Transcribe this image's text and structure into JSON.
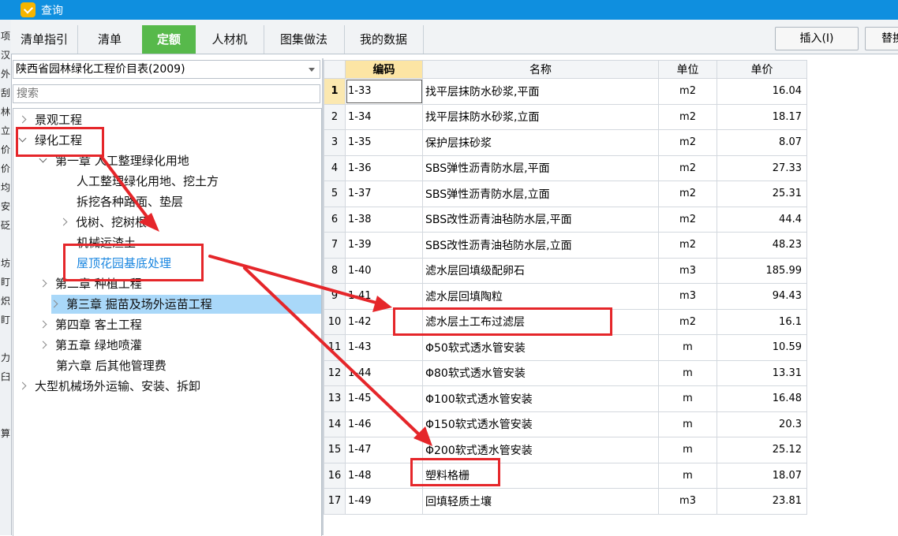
{
  "window": {
    "title": "查询"
  },
  "edge_chars": [
    "项",
    "汉",
    "外",
    "刮",
    "林",
    "立",
    "价",
    "价",
    "均",
    "安",
    "砭",
    "",
    "坊",
    "盯",
    "炽",
    "盯",
    "",
    "力",
    "臼",
    "",
    "",
    "算"
  ],
  "tabs": [
    {
      "label": "清单指引",
      "active": false
    },
    {
      "label": "清单",
      "active": false
    },
    {
      "label": "定额",
      "active": true
    },
    {
      "label": "人材机",
      "active": false
    },
    {
      "label": "图集做法",
      "active": false
    },
    {
      "label": "我的数据",
      "active": false
    }
  ],
  "toolbar": {
    "insert_label": "插入(I)",
    "replace_label": "替换"
  },
  "library": {
    "selected": "陕西省园林绿化工程价目表(2009)"
  },
  "search": {
    "placeholder": "搜索",
    "value": ""
  },
  "tree": [
    {
      "label": "景观工程",
      "level": 0,
      "toggle": "collapsed"
    },
    {
      "label": "绿化工程",
      "level": 0,
      "toggle": "expanded"
    },
    {
      "label": "第一章 人工整理绿化用地",
      "level": 1,
      "toggle": "expanded"
    },
    {
      "label": "人工整理绿化用地、挖土方",
      "level": 2,
      "toggle": "none"
    },
    {
      "label": "拆挖各种路面、垫层",
      "level": 2,
      "toggle": "none"
    },
    {
      "label": "伐树、挖树根",
      "level": 2,
      "toggle": "collapsed"
    },
    {
      "label": "机械运渣土",
      "level": 2,
      "toggle": "none"
    },
    {
      "label": "屋顶花园基底处理",
      "level": 2,
      "toggle": "none",
      "highlight": "blue"
    },
    {
      "label": "第二章 种植工程",
      "level": 1,
      "toggle": "collapsed"
    },
    {
      "label": "第三章 掘苗及场外运苗工程",
      "level": 1,
      "toggle": "collapsed",
      "selected": true
    },
    {
      "label": "第四章 客土工程",
      "level": 1,
      "toggle": "collapsed"
    },
    {
      "label": "第五章 绿地喷灌",
      "level": 1,
      "toggle": "collapsed"
    },
    {
      "label": "第六章 后其他管理费",
      "level": 1,
      "toggle": "none"
    },
    {
      "label": "大型机械场外运输、安装、拆卸",
      "level": 0,
      "toggle": "collapsed"
    }
  ],
  "grid": {
    "columns": [
      "编码",
      "名称",
      "单位",
      "单价"
    ],
    "rows": [
      {
        "no": "1",
        "code": "1-33",
        "name": "找平层抹防水砂浆,平面",
        "unit": "m2",
        "price": "16.04"
      },
      {
        "no": "2",
        "code": "1-34",
        "name": "找平层抹防水砂浆,立面",
        "unit": "m2",
        "price": "18.17"
      },
      {
        "no": "3",
        "code": "1-35",
        "name": "保护层抹砂浆",
        "unit": "m2",
        "price": "8.07"
      },
      {
        "no": "4",
        "code": "1-36",
        "name": "SBS弹性沥青防水层,平面",
        "unit": "m2",
        "price": "27.33"
      },
      {
        "no": "5",
        "code": "1-37",
        "name": "SBS弹性沥青防水层,立面",
        "unit": "m2",
        "price": "25.31"
      },
      {
        "no": "6",
        "code": "1-38",
        "name": "SBS改性沥青油毡防水层,平面",
        "unit": "m2",
        "price": "44.4"
      },
      {
        "no": "7",
        "code": "1-39",
        "name": "SBS改性沥青油毡防水层,立面",
        "unit": "m2",
        "price": "48.23"
      },
      {
        "no": "8",
        "code": "1-40",
        "name": "滤水层回填级配卵石",
        "unit": "m3",
        "price": "185.99"
      },
      {
        "no": "9",
        "code": "1-41",
        "name": "滤水层回填陶粒",
        "unit": "m3",
        "price": "94.43"
      },
      {
        "no": "10",
        "code": "1-42",
        "name": "滤水层土工布过滤层",
        "unit": "m2",
        "price": "16.1"
      },
      {
        "no": "11",
        "code": "1-43",
        "name": "Φ50软式透水管安装",
        "unit": "m",
        "price": "10.59"
      },
      {
        "no": "12",
        "code": "1-44",
        "name": "Φ80软式透水管安装",
        "unit": "m",
        "price": "13.31"
      },
      {
        "no": "13",
        "code": "1-45",
        "name": "Φ100软式透水管安装",
        "unit": "m",
        "price": "16.48"
      },
      {
        "no": "14",
        "code": "1-46",
        "name": "Φ150软式透水管安装",
        "unit": "m",
        "price": "20.3"
      },
      {
        "no": "15",
        "code": "1-47",
        "name": "Φ200软式透水管安装",
        "unit": "m",
        "price": "25.12"
      },
      {
        "no": "16",
        "code": "1-48",
        "name": "塑料格栅",
        "unit": "m",
        "price": "18.07"
      },
      {
        "no": "17",
        "code": "1-49",
        "name": "回填轻质土壤",
        "unit": "m3",
        "price": "23.81"
      }
    ]
  },
  "annotation_color": "#e5262a"
}
